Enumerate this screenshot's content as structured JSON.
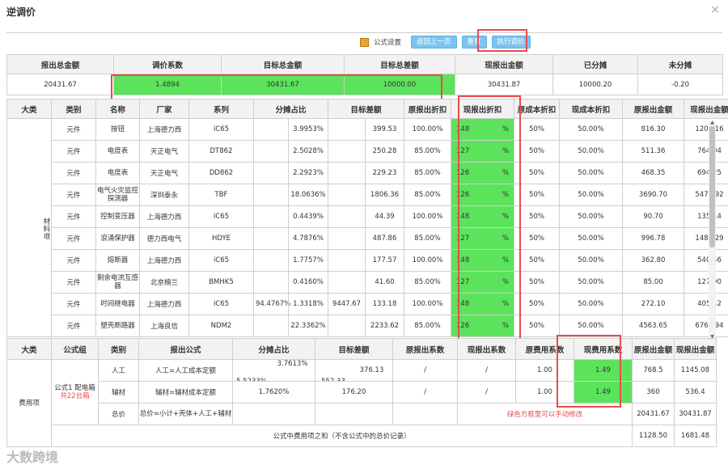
{
  "title": "逆调价",
  "close_glyph": "×",
  "toolbar": {
    "formula_settings": "公式设置",
    "back_label": "返回上一页",
    "reset_label": "重置",
    "execute_label": "执行调价"
  },
  "summary": {
    "headers": [
      "报出总金额",
      "调价系数",
      "目标总金额",
      "目标总差额",
      "现报出金额",
      "已分摊",
      "未分摊"
    ],
    "values": [
      "20431.67",
      "1.4894",
      "30431.67",
      "10000.00",
      "30431.87",
      "10000.20",
      "-0.20"
    ]
  },
  "materials": {
    "headers": [
      "大类",
      "类别",
      "名称",
      "厂家",
      "系列",
      "分摊占比",
      "目标差额",
      "原报出折扣",
      "现报出折扣",
      "原成本折扣",
      "现成本折扣",
      "原报出金额",
      "现报出金额"
    ],
    "category": "材料项",
    "merged_share": "94.4767%",
    "merged_diff": "9447.67",
    "rows": [
      {
        "type": "元件",
        "name": "按钮",
        "maker": "上海德力西",
        "series": "iC65",
        "share": "3.9953%",
        "diff": "399.53",
        "orig_disc": "100.00%",
        "cur_disc": "148",
        "orig_cost": "50%",
        "cur_cost": "50.00%",
        "orig_amt": "816.30",
        "cur_amt": "1208.16"
      },
      {
        "type": "元件",
        "name": "电度表",
        "maker": "天正电气",
        "series": "DT862",
        "share": "2.5028%",
        "diff": "250.28",
        "orig_disc": "85.00%",
        "cur_disc": "127",
        "orig_cost": "50%",
        "cur_cost": "50.00%",
        "orig_amt": "511.36",
        "cur_amt": "764.04"
      },
      {
        "type": "元件",
        "name": "电度表",
        "maker": "天正电气",
        "series": "DD862",
        "share": "2.2923%",
        "diff": "229.23",
        "orig_disc": "85.00%",
        "cur_disc": "126",
        "orig_cost": "50%",
        "cur_cost": "50.00%",
        "orig_amt": "468.35",
        "cur_amt": "694.25"
      },
      {
        "type": "元件",
        "name": "电气火灾监控探测器",
        "maker": "深圳泰永",
        "series": "TBF",
        "share": "18.0636%",
        "diff": "1806.36",
        "orig_disc": "85.00%",
        "cur_disc": "126",
        "orig_cost": "50%",
        "cur_cost": "50.00%",
        "orig_amt": "3690.70",
        "cur_amt": "5470.92"
      },
      {
        "type": "元件",
        "name": "控制变压器",
        "maker": "上海德力西",
        "series": "iC65",
        "share": "0.4439%",
        "diff": "44.39",
        "orig_disc": "100.00%",
        "cur_disc": "148",
        "orig_cost": "50%",
        "cur_cost": "50.00%",
        "orig_amt": "90.70",
        "cur_amt": "135.14"
      },
      {
        "type": "元件",
        "name": "浪涌保护器",
        "maker": "德力西电气",
        "series": "HDYE",
        "share": "4.7876%",
        "diff": "487.86",
        "orig_disc": "85.00%",
        "cur_disc": "127",
        "orig_cost": "50%",
        "cur_cost": "50.00%",
        "orig_amt": "996.78",
        "cur_amt": "1489.29"
      },
      {
        "type": "元件",
        "name": "熔断器",
        "maker": "上海德力西",
        "series": "iC65",
        "share": "1.7757%",
        "diff": "177.57",
        "orig_disc": "100.00%",
        "cur_disc": "148",
        "orig_cost": "50%",
        "cur_cost": "50.00%",
        "orig_amt": "362.80",
        "cur_amt": "540.56"
      },
      {
        "type": "元件",
        "name": "剩余电流互感器",
        "maker": "北京楠兰",
        "series": "BMHK5",
        "share": "0.4160%",
        "diff": "41.60",
        "orig_disc": "85.00%",
        "cur_disc": "127",
        "orig_cost": "50%",
        "cur_cost": "50.00%",
        "orig_amt": "85.00",
        "cur_amt": "127.00"
      },
      {
        "type": "元件",
        "name": "时间继电器",
        "maker": "上海德力西",
        "series": "iC65",
        "share": "1.3318%",
        "diff": "133.18",
        "orig_disc": "100.00%",
        "cur_disc": "148",
        "orig_cost": "50%",
        "cur_cost": "50.00%",
        "orig_amt": "272.10",
        "cur_amt": "405.42"
      },
      {
        "type": "元件",
        "name": "塑壳断路器",
        "maker": "上海良信",
        "series": "NDM2",
        "share": "22.3362%",
        "diff": "2233.62",
        "orig_disc": "85.00%",
        "cur_disc": "126",
        "orig_cost": "50%",
        "cur_cost": "50.00%",
        "orig_amt": "4563.65",
        "cur_amt": "6764.94"
      }
    ]
  },
  "fees": {
    "headers": [
      "大类",
      "公式组",
      "类别",
      "报出公式",
      "分摊占比",
      "目标差额",
      "原报出系数",
      "现报出系数",
      "原费用系数",
      "现费用系数",
      "原报出金额",
      "现报出金额"
    ],
    "category": "费用项",
    "group_label": "公式1",
    "group_name": "配电箱",
    "group_count": "共22台箱",
    "merged_share": "5.5233%",
    "merged_diff": "552.33",
    "rows": [
      {
        "type": "人工",
        "formula": "人工=人工成本定额",
        "share": "3.7613%",
        "diff": "376.13",
        "orig_coef": "/",
        "cur_coef": "/",
        "orig_fee": "1.00",
        "cur_fee": "1.49",
        "orig_amt": "768.5",
        "cur_amt": "1145.08"
      },
      {
        "type": "辅材",
        "formula": "辅材=辅材成本定额",
        "share": "1.7620%",
        "diff": "176.20",
        "orig_coef": "/",
        "cur_coef": "/",
        "orig_fee": "1.00",
        "cur_fee": "1.49",
        "orig_amt": "360",
        "cur_amt": "536.4"
      }
    ],
    "total_row": {
      "type": "总价",
      "formula": "总价=小计+壳体+人工+辅材",
      "note": "绿色方框里可以手动修改",
      "orig_amt": "20431.67",
      "cur_amt": "30431.87"
    },
    "sum_row": {
      "label": "公式中费用项之和（不含公式中的总价记录）",
      "orig_amt": "1128.50",
      "cur_amt": "1681.48"
    }
  },
  "pct_symbol": "%",
  "watermark": "大数跨境"
}
